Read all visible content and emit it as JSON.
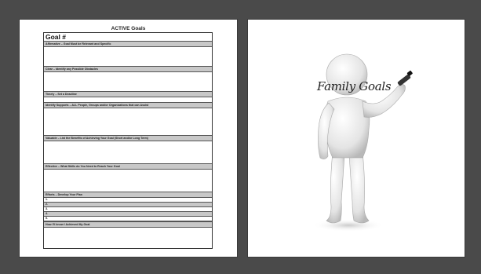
{
  "left_page": {
    "title": "ACTIVE Goals",
    "goal_header": "Goal #",
    "sections": [
      {
        "label": "Affirmative – Goal Must be Relevant and Specific"
      },
      {
        "label": "Clear – Identify any Possible Obstacles"
      },
      {
        "label": "Timely – Set a Deadline"
      },
      {
        "label": "Identify Supports – ALL People, Groups and/or Organizations that can Assist"
      },
      {
        "label": "Valuable – List the Benefits of Achieving Your Goal (Short and/or Long Term)"
      },
      {
        "label": "Effective – What Skills do You Need to Reach Your Goal"
      },
      {
        "label": "Efforts – Develop Your Plan"
      }
    ],
    "plan_steps": [
      "1.",
      "2.",
      "3.",
      "4.",
      "5."
    ],
    "final_label": "How I'll know I Achieved My Goal"
  },
  "right_page": {
    "caption": "Family Goals",
    "figure_icon": "stick-figure-with-marker-icon"
  }
}
